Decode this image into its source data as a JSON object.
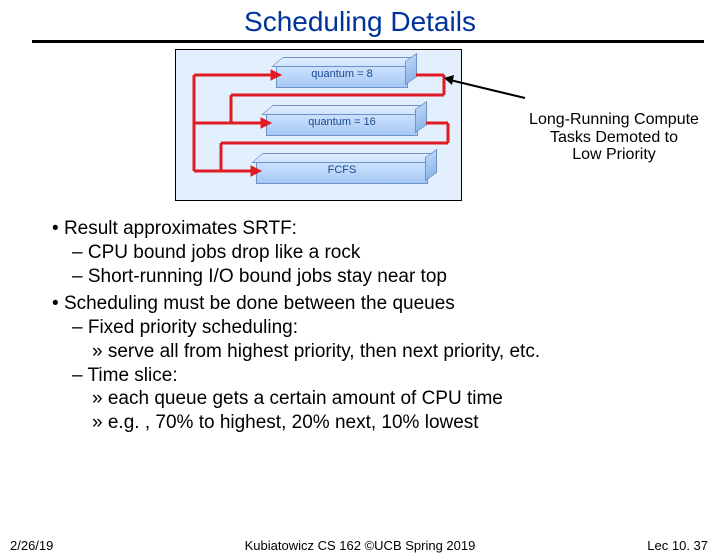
{
  "title": "Scheduling Details",
  "diagram": {
    "queues": [
      {
        "label": "quantum = 8"
      },
      {
        "label": "quantum = 16"
      },
      {
        "label": "FCFS"
      }
    ],
    "annotation_l1": "Long-Running Compute",
    "annotation_l2": "Tasks Demoted to",
    "annotation_l3": "Low Priority"
  },
  "bullets": {
    "b1": "Result approximates SRTF:",
    "b1a": "CPU bound jobs drop like a rock",
    "b1b": "Short-running I/O bound jobs stay near top",
    "b2": "Scheduling must be done between the queues",
    "b2a": "Fixed priority scheduling:",
    "b2a1": "serve all from highest priority, then next priority, etc.",
    "b2b": "Time slice:",
    "b2b1": "each queue gets a certain amount of CPU time",
    "b2b2": "e.g. , 70% to highest, 20% next, 10% lowest"
  },
  "footer": {
    "date": "2/26/19",
    "center": "Kubiatowicz CS 162 ©UCB Spring 2019",
    "right": "Lec 10. 37"
  }
}
